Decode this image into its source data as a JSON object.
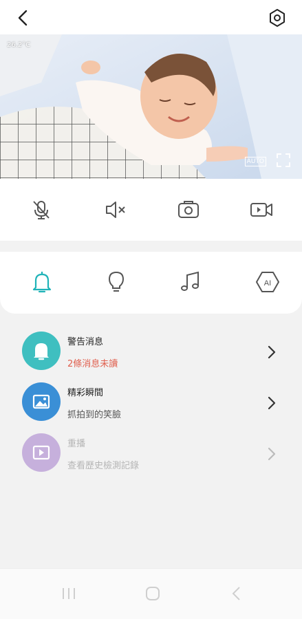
{
  "header": {
    "back_icon": "chevron-left-icon",
    "settings_icon": "gear-icon"
  },
  "video": {
    "temperature": "26.2°C",
    "auto_label": "AUTO",
    "fullscreen_icon": "fullscreen-icon"
  },
  "controls": [
    {
      "icon": "mic-off-icon"
    },
    {
      "icon": "speaker-mute-icon"
    },
    {
      "icon": "snapshot-icon"
    },
    {
      "icon": "video-record-icon"
    }
  ],
  "tabs": [
    {
      "icon": "bell-icon",
      "active": true
    },
    {
      "icon": "lightbulb-icon",
      "active": false
    },
    {
      "icon": "music-note-icon",
      "active": false
    },
    {
      "icon": "ai-icon",
      "active": false
    }
  ],
  "list": [
    {
      "title": "警告消息",
      "subtitle": "2條消息未讀",
      "icon": "bell-icon",
      "color": "#3fbfc0",
      "subtitle_color": "#e0604f"
    },
    {
      "title": "精彩瞬間",
      "subtitle": "抓拍到的笑臉",
      "icon": "image-icon",
      "color": "#3a8fd6",
      "subtitle_color": "#555555"
    },
    {
      "title": "重播",
      "subtitle": "查看歷史檢測記錄",
      "icon": "play-icon",
      "color": "#c6b0dc",
      "subtitle_color": "#b5b5b5"
    }
  ],
  "colors": {
    "accent": "#1fb3b8",
    "icon_gray": "#555555"
  },
  "navbar": [
    {
      "icon": "recent-apps-icon"
    },
    {
      "icon": "home-icon"
    },
    {
      "icon": "back-nav-icon"
    }
  ]
}
